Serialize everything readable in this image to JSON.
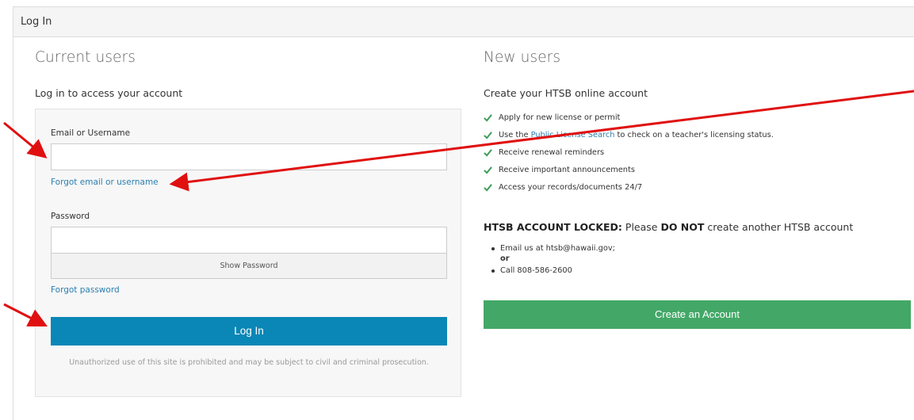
{
  "panel": {
    "title": "Log In"
  },
  "current_users": {
    "heading": "Current users",
    "subheading": "Log in to access your account",
    "email_label": "Email or Username",
    "email_value": "",
    "forgot_email": "Forgot email or username",
    "password_label": "Password",
    "password_value": "",
    "show_password": "Show Password",
    "forgot_password": "Forgot password",
    "login_button": "Log In",
    "disclaimer": "Unauthorized use of this site is prohibited and may be subject to civil and criminal prosecution."
  },
  "new_users": {
    "heading": "New users",
    "subheading": "Create your HTSB online account",
    "features": [
      {
        "text": "Apply for new license or permit"
      },
      {
        "pre": "Use the ",
        "link": "Public License Search",
        "post": " to check on a teacher's licensing status."
      },
      {
        "text": "Receive renewal reminders"
      },
      {
        "text": "Receive important announcements"
      },
      {
        "text": "Access your records/documents 24/7"
      }
    ],
    "locked_bold": "HTSB ACCOUNT LOCKED:",
    "locked_text1": " Please ",
    "locked_do_not": "DO NOT",
    "locked_text2": " create another HTSB account",
    "contact_email": "Email us at htsb@hawaii.gov;",
    "contact_or": "or",
    "contact_call": "Call 808-586-2600",
    "create_button": "Create an Account"
  },
  "colors": {
    "link": "#2a7fb0",
    "login_button": "#0a87b6",
    "create_button": "#43a867",
    "check": "#3c9c5a",
    "annotation_arrow": "#e01010"
  },
  "icons": {
    "check": "check-icon"
  }
}
